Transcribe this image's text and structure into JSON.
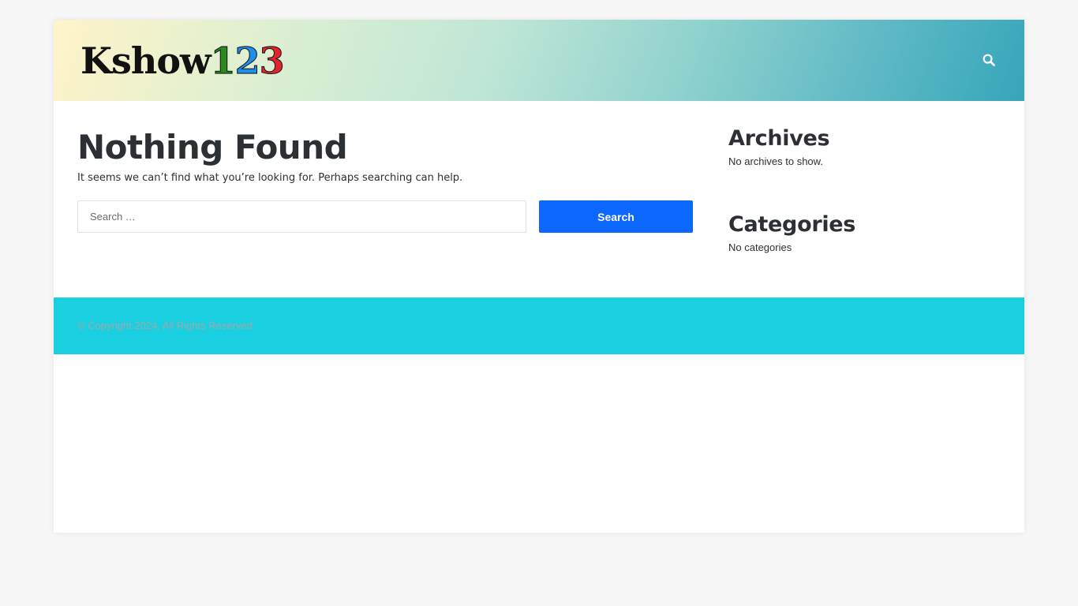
{
  "header": {
    "logo": {
      "part1": "Kshow",
      "part2": "1",
      "part3": "2",
      "part4": "3"
    },
    "search_icon": "search-icon",
    "gradient_colors": [
      "#fff4c9",
      "#36a6b9"
    ]
  },
  "main": {
    "title": "Nothing Found",
    "description": "It seems we can’t find what you’re looking for. Perhaps searching can help.",
    "search": {
      "placeholder": "Search …",
      "value": "",
      "button_label": "Search",
      "button_color": "#0c67ff"
    }
  },
  "sidebar": {
    "archives": {
      "title": "Archives",
      "text": "No archives to show."
    },
    "categories": {
      "title": "Categories",
      "text": "No categories"
    }
  },
  "footer": {
    "copyright": "© Copyright 2024, All Rights Reserved",
    "background": "#1ad0e0"
  }
}
